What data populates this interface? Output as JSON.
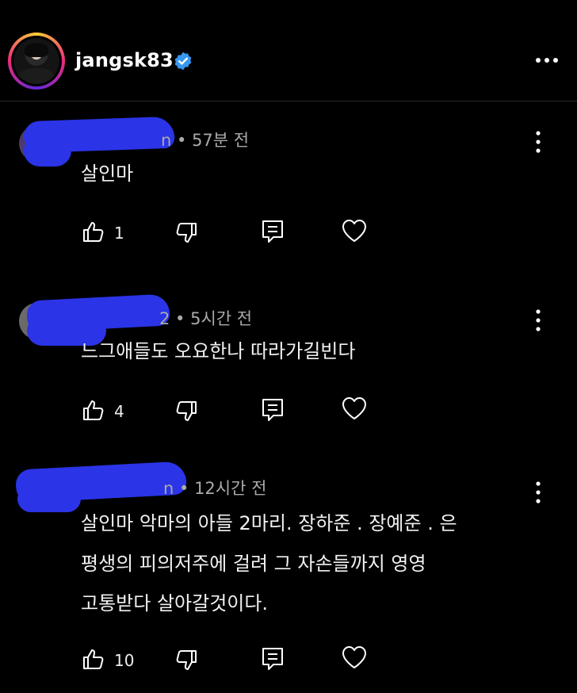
{
  "header": {
    "username": "jangsk83",
    "verified": true
  },
  "comments": [
    {
      "author_tail": "n",
      "time": "57분 전",
      "lines": [
        "살인마"
      ],
      "likes": "1"
    },
    {
      "author_tail": "2",
      "time": "5시간 전",
      "lines": [
        "느그애들도 오요한나 따라가길빈다"
      ],
      "likes": "4"
    },
    {
      "author_tail": "n",
      "time": "12시간 전",
      "lines": [
        "살인마 악마의 아들 2마리. 장하준 . 장예준 . 은",
        "평생의 피의저주에 걸려 그 자손들까지 영영",
        "고통받다 살아갈것이다."
      ],
      "likes": "10"
    }
  ],
  "icons": {
    "like": "thumbs-up-icon",
    "dislike": "thumbs-down-icon",
    "reply": "reply-icon",
    "heart": "heart-icon",
    "more": "more-vertical-icon"
  },
  "colors": {
    "background": "#000000",
    "redaction": "#2b34e6",
    "verified": "#3897f0"
  }
}
